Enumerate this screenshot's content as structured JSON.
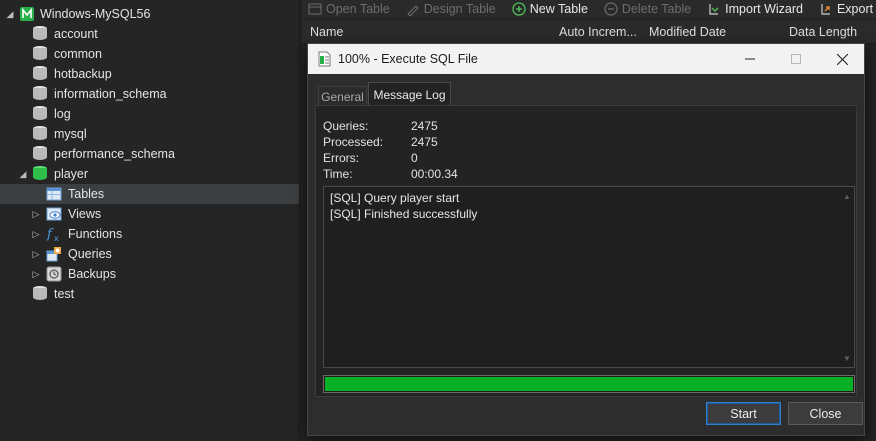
{
  "navigator": {
    "connection": {
      "label": "Windows-MySQL56",
      "expanded": true
    },
    "databases": [
      {
        "label": "account",
        "open": false
      },
      {
        "label": "common",
        "open": false
      },
      {
        "label": "hotbackup",
        "open": false
      },
      {
        "label": "information_schema",
        "open": false
      },
      {
        "label": "log",
        "open": false
      },
      {
        "label": "mysql",
        "open": false
      },
      {
        "label": "performance_schema",
        "open": false
      },
      {
        "label": "player",
        "open": true
      },
      {
        "label": "test",
        "open": false
      }
    ],
    "player_children": [
      {
        "label": "Tables",
        "icon": "table-icon",
        "selected": true
      },
      {
        "label": "Views",
        "icon": "view-icon",
        "selected": false
      },
      {
        "label": "Functions",
        "icon": "function-icon",
        "selected": false
      },
      {
        "label": "Queries",
        "icon": "query-icon",
        "selected": false
      },
      {
        "label": "Backups",
        "icon": "backup-icon",
        "selected": false
      }
    ]
  },
  "toolbar": {
    "open_table": "Open Table",
    "design_table": "Design Table",
    "new_table": "New Table",
    "delete_table": "Delete Table",
    "import_wizard": "Import Wizard",
    "export_wizard": "Export Wizard"
  },
  "columns": {
    "name": "Name",
    "auto_increment": "Auto Increm...",
    "modified_date": "Modified Date",
    "data_length": "Data Length"
  },
  "dialog": {
    "title": "100% - Execute SQL File",
    "tabs": {
      "general": "General",
      "message_log": "Message Log"
    },
    "stats": {
      "queries_label": "Queries:",
      "queries_value": "2475",
      "processed_label": "Processed:",
      "processed_value": "2475",
      "errors_label": "Errors:",
      "errors_value": "0",
      "time_label": "Time:",
      "time_value": "00:00.34"
    },
    "log_lines": [
      "[SQL] Query player start",
      "[SQL] Finished successfully"
    ],
    "progress_percent": 100,
    "start_button": "Start",
    "close_button": "Close"
  },
  "colors": {
    "progress_fill": "#06b025",
    "db_closed": "#c8c8c8",
    "db_open": "#2fbf4a",
    "connection_green": "#27b04a",
    "selected_row": "#3c3f41"
  }
}
